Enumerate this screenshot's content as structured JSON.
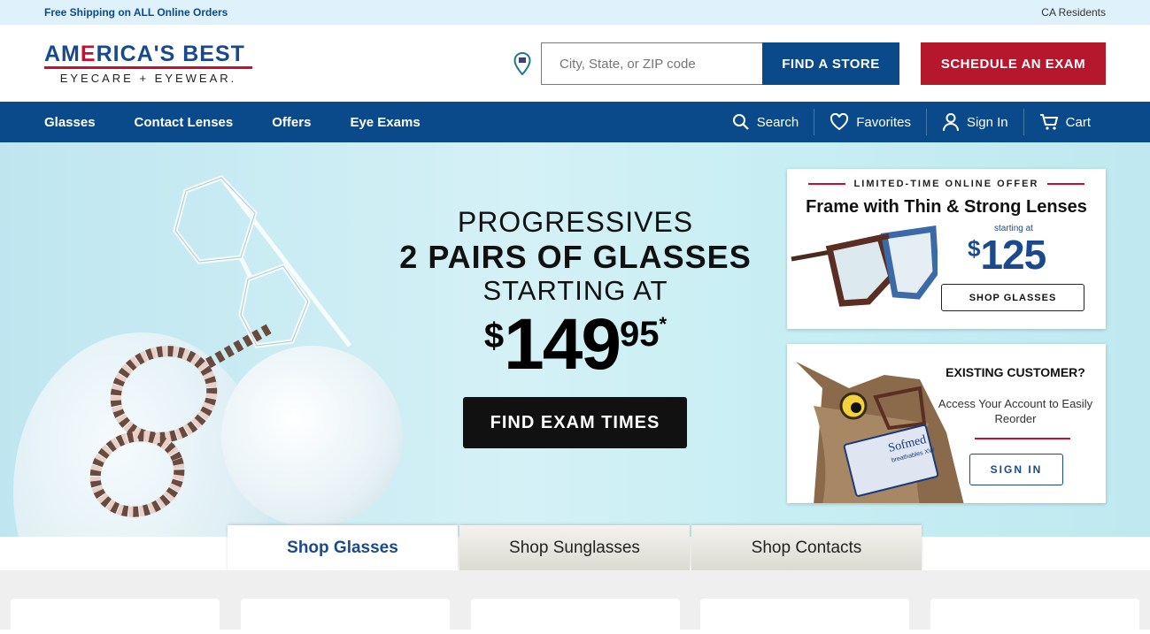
{
  "topbar": {
    "shipping": "Free Shipping on ALL Online Orders",
    "ca": "CA Residents"
  },
  "brand": {
    "line1_a": "AM",
    "line1_b": "E",
    "line1_c": "RICA'S BEST",
    "line2": "EYECARE + EYEWEAR."
  },
  "header": {
    "search_placeholder": "City, State, or ZIP code",
    "find_store": "FIND A STORE",
    "schedule_exam": "SCHEDULE AN EXAM"
  },
  "nav": {
    "items": [
      {
        "label": "Glasses"
      },
      {
        "label": "Contact Lenses"
      },
      {
        "label": "Offers"
      },
      {
        "label": "Eye Exams"
      }
    ],
    "right": [
      {
        "label": "Search",
        "icon": "search-icon"
      },
      {
        "label": "Favorites",
        "icon": "heart-icon"
      },
      {
        "label": "Sign In",
        "icon": "user-icon"
      },
      {
        "label": "Cart",
        "icon": "cart-icon"
      }
    ]
  },
  "hero": {
    "line1": "PROGRESSIVES",
    "line2": "2 PAIRS OF GLASSES",
    "line3": "STARTING AT",
    "price_dollar": "$",
    "price_main": "149",
    "price_cents": "95",
    "price_mark": "*",
    "cta": "FIND EXAM TIMES"
  },
  "offer_card": {
    "eyebrow": "LIMITED-TIME ONLINE OFFER",
    "title": "Frame with Thin & Strong Lenses",
    "starting": "starting at",
    "price_dollar": "$",
    "price": "125",
    "cta": "SHOP GLASSES"
  },
  "customer_card": {
    "title": "EXISTING CUSTOMER?",
    "text": "Access Your Account to Easily Reorder",
    "cta": "SIGN IN",
    "product_brand": "Sofmed",
    "product_sub": "breathables XW"
  },
  "tabs": [
    {
      "label": "Shop Glasses",
      "active": true
    },
    {
      "label": "Shop Sunglasses",
      "active": false
    },
    {
      "label": "Shop Contacts",
      "active": false
    }
  ],
  "colors": {
    "navy": "#0a4a8a",
    "red": "#b5182d",
    "hero_bg": "#c6eef3"
  }
}
